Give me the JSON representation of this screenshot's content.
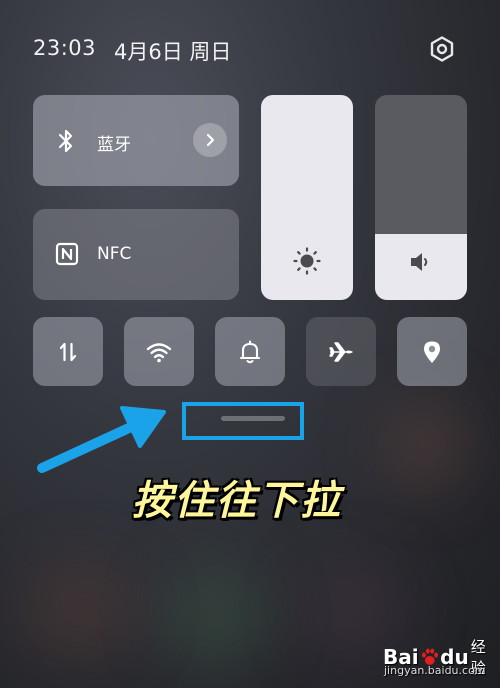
{
  "status": {
    "time": "23:03",
    "date": "4月6日 周日"
  },
  "tiles": {
    "bluetooth": {
      "label": "蓝牙",
      "icon": "bluetooth-icon"
    },
    "nfc": {
      "label": "NFC",
      "icon": "nfc-icon"
    }
  },
  "sliders": {
    "brightness": {
      "icon": "sun-icon",
      "level": 1.0
    },
    "volume": {
      "icon": "speaker-icon",
      "level": 0.32
    }
  },
  "quick_toggles": [
    {
      "name": "mobile-data",
      "icon": "data-transfer-icon",
      "on": true
    },
    {
      "name": "wifi",
      "icon": "wifi-icon",
      "on": true
    },
    {
      "name": "sound",
      "icon": "bell-icon",
      "on": true
    },
    {
      "name": "airplane",
      "icon": "airplane-icon",
      "on": false
    },
    {
      "name": "location",
      "icon": "location-icon",
      "on": true
    }
  ],
  "annotation": {
    "caption": "按住往下拉",
    "highlight_color": "#1aa3e8",
    "caption_color": "#fff59a"
  },
  "watermark": {
    "brand": "Bai",
    "brand_suffix": "du",
    "product": "经验",
    "url": "jingyan.baidu.com"
  }
}
